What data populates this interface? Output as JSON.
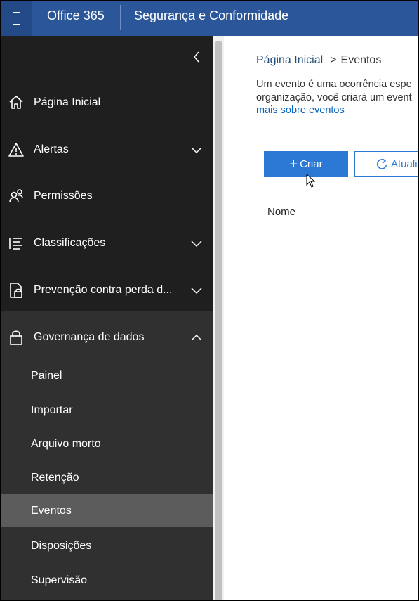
{
  "header": {
    "app_name": "Office 365",
    "suite_title": "Segurança e Conformidade"
  },
  "sidebar": {
    "items": [
      {
        "label": "Página Inicial",
        "icon": "home-icon"
      },
      {
        "label": "Alertas",
        "icon": "warning-icon",
        "expandable": true
      },
      {
        "label": "Permissões",
        "icon": "people-icon"
      },
      {
        "label": "Classificações",
        "icon": "list-icon",
        "expandable": true
      },
      {
        "label": "Prevenção contra perda d...",
        "icon": "document-lock-icon",
        "expandable": true
      },
      {
        "label": "Governança de dados",
        "icon": "lock-icon",
        "expanded": true
      }
    ],
    "subitems": [
      {
        "label": "Painel"
      },
      {
        "label": "Importar"
      },
      {
        "label": "Arquivo morto"
      },
      {
        "label": "Retenção"
      },
      {
        "label": "Eventos",
        "active": true
      },
      {
        "label": "Disposições"
      },
      {
        "label": "Supervisão"
      }
    ]
  },
  "main": {
    "breadcrumb_home": "Página Inicial",
    "breadcrumb_sep": ">",
    "breadcrumb_current": "Eventos",
    "desc_line1": "Um evento é uma ocorrência espe",
    "desc_line2": "organização, você criará um event",
    "desc_link": "mais sobre eventos",
    "create_label": "Criar",
    "refresh_label": "Atuali",
    "column_name": "Nome"
  },
  "colors": {
    "topbar": "#2b579a",
    "sidebar": "#1f1f1f",
    "sidebar_group": "#303030",
    "active_item": "#5c5c5c",
    "primary_button": "#2b78d5",
    "link": "#0563c1"
  }
}
